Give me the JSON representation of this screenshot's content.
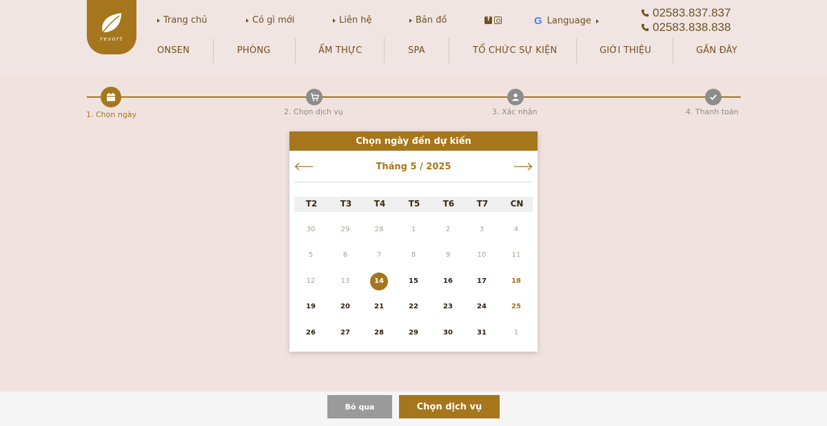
{
  "header": {
    "logo_text": "resort",
    "top_links": [
      "Trang chủ",
      "Có gì mới",
      "Liên hệ",
      "Bản đồ"
    ],
    "language_label": "Language",
    "google_icon": "G",
    "phones": [
      "02583.837.837",
      "02583.838.838"
    ],
    "nav": [
      "ONSEN",
      "PHÒNG",
      "ẨM THỰC",
      "SPA",
      "TỔ CHỨC SỰ KIỆN",
      "GIỚI THIỆU",
      "GẦN ĐÂY"
    ]
  },
  "steps": [
    {
      "label": "1. Chọn ngày",
      "icon": "calendar-icon",
      "active": true
    },
    {
      "label": "2. Chọn dịch vụ",
      "icon": "cart-icon",
      "active": false
    },
    {
      "label": "3. Xác nhận",
      "icon": "user-icon",
      "active": false
    },
    {
      "label": "4. Thanh toán",
      "icon": "check-icon",
      "active": false
    }
  ],
  "calendar": {
    "title": "Chọn ngày đến dự kiến",
    "month_label": "Tháng 5 / 2025",
    "weekdays": [
      "T2",
      "T3",
      "T4",
      "T5",
      "T6",
      "T7",
      "CN"
    ],
    "weeks": [
      [
        "30",
        "29",
        "28",
        "1",
        "2",
        "3",
        "4"
      ],
      [
        "5",
        "6",
        "7",
        "8",
        "9",
        "10",
        "11"
      ],
      [
        "12",
        "13",
        "14",
        "15",
        "16",
        "17",
        "18"
      ],
      [
        "19",
        "20",
        "21",
        "22",
        "23",
        "24",
        "25"
      ],
      [
        "26",
        "27",
        "28",
        "29",
        "30",
        "31",
        "1"
      ]
    ],
    "selected_day": "14"
  },
  "footer": {
    "skip_label": "Bỏ qua",
    "next_label": "Chọn dịch vụ"
  },
  "colors": {
    "accent": "#a5761b",
    "inactive": "#8c8c8c",
    "background": "#f0e2df"
  }
}
